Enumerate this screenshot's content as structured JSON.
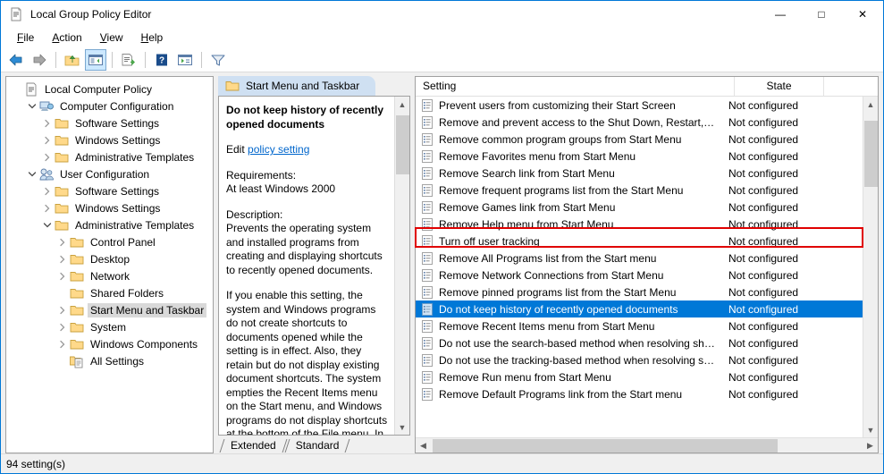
{
  "window": {
    "title": "Local Group Policy Editor",
    "icon": "policy-editor-icon",
    "controls": {
      "minimize": "—",
      "maximize": "□",
      "close": "✕"
    }
  },
  "menubar": [
    {
      "label": "File",
      "accel": "F"
    },
    {
      "label": "Action",
      "accel": "A"
    },
    {
      "label": "View",
      "accel": "V"
    },
    {
      "label": "Help",
      "accel": "H"
    }
  ],
  "toolbar": [
    {
      "name": "back-icon",
      "active": false
    },
    {
      "name": "forward-icon",
      "active": false
    },
    {
      "sep": true
    },
    {
      "name": "up-folder-icon",
      "active": false
    },
    {
      "name": "show-hide-tree-icon",
      "active": true
    },
    {
      "sep": true
    },
    {
      "name": "export-list-icon",
      "active": false
    },
    {
      "sep": true
    },
    {
      "name": "help-icon",
      "active": false
    },
    {
      "name": "properties-icon",
      "active": false
    },
    {
      "sep": true
    },
    {
      "name": "filter-icon",
      "active": false
    }
  ],
  "tree": {
    "items": [
      {
        "label": "Local Computer Policy",
        "depth": 0,
        "twisty": "none",
        "icon": "policy-icon",
        "selected": false
      },
      {
        "label": "Computer Configuration",
        "depth": 1,
        "twisty": "open",
        "icon": "computer-icon",
        "selected": false
      },
      {
        "label": "Software Settings",
        "depth": 2,
        "twisty": "closed",
        "icon": "folder-icon",
        "selected": false
      },
      {
        "label": "Windows Settings",
        "depth": 2,
        "twisty": "closed",
        "icon": "folder-icon",
        "selected": false
      },
      {
        "label": "Administrative Templates",
        "depth": 2,
        "twisty": "closed",
        "icon": "folder-icon",
        "selected": false
      },
      {
        "label": "User Configuration",
        "depth": 1,
        "twisty": "open",
        "icon": "user-icon",
        "selected": false
      },
      {
        "label": "Software Settings",
        "depth": 2,
        "twisty": "closed",
        "icon": "folder-icon",
        "selected": false
      },
      {
        "label": "Windows Settings",
        "depth": 2,
        "twisty": "closed",
        "icon": "folder-icon",
        "selected": false
      },
      {
        "label": "Administrative Templates",
        "depth": 2,
        "twisty": "open",
        "icon": "folder-icon",
        "selected": false
      },
      {
        "label": "Control Panel",
        "depth": 3,
        "twisty": "closed",
        "icon": "folder-icon",
        "selected": false
      },
      {
        "label": "Desktop",
        "depth": 3,
        "twisty": "closed",
        "icon": "folder-icon",
        "selected": false
      },
      {
        "label": "Network",
        "depth": 3,
        "twisty": "closed",
        "icon": "folder-icon",
        "selected": false
      },
      {
        "label": "Shared Folders",
        "depth": 3,
        "twisty": "none",
        "icon": "folder-icon",
        "selected": false
      },
      {
        "label": "Start Menu and Taskbar",
        "depth": 3,
        "twisty": "closed",
        "icon": "folder-icon",
        "selected": true
      },
      {
        "label": "System",
        "depth": 3,
        "twisty": "closed",
        "icon": "folder-icon",
        "selected": false
      },
      {
        "label": "Windows Components",
        "depth": 3,
        "twisty": "closed",
        "icon": "folder-icon",
        "selected": false
      },
      {
        "label": "All Settings",
        "depth": 3,
        "twisty": "none",
        "icon": "all-settings-icon",
        "selected": false
      }
    ]
  },
  "details": {
    "tab_label": "Start Menu and Taskbar",
    "tab_icon": "folder-icon",
    "policy_title": "Do not keep history of recently opened documents",
    "edit_prefix": "Edit ",
    "edit_link": "policy setting",
    "requirements_label": "Requirements:",
    "requirements_value": "At least Windows 2000",
    "description_label": "Description:",
    "description_p1": "Prevents the operating system and installed programs from creating and displaying shortcuts to recently opened documents.",
    "description_p2": "If you enable this setting, the system and Windows programs do not create shortcuts to documents opened while the setting is in effect. Also, they retain but do not display existing document shortcuts. The system empties the Recent Items menu on the Start menu, and Windows programs do not display shortcuts at the bottom of the File menu. In",
    "bottom_tabs": [
      {
        "label": "Extended",
        "active": false
      },
      {
        "label": "Standard",
        "active": true
      }
    ]
  },
  "list": {
    "columns": {
      "setting": "Setting",
      "state": "State"
    },
    "rows": [
      {
        "setting": "Prevent users from customizing their Start Screen",
        "state": "Not configured",
        "selected": false
      },
      {
        "setting": "Remove and prevent access to the Shut Down, Restart, Sleep...",
        "state": "Not configured",
        "selected": false
      },
      {
        "setting": "Remove common program groups from Start Menu",
        "state": "Not configured",
        "selected": false
      },
      {
        "setting": "Remove Favorites menu from Start Menu",
        "state": "Not configured",
        "selected": false
      },
      {
        "setting": "Remove Search link from Start Menu",
        "state": "Not configured",
        "selected": false
      },
      {
        "setting": "Remove frequent programs list from the Start Menu",
        "state": "Not configured",
        "selected": false
      },
      {
        "setting": "Remove Games link from Start Menu",
        "state": "Not configured",
        "selected": false
      },
      {
        "setting": "Remove Help menu from Start Menu",
        "state": "Not configured",
        "selected": false
      },
      {
        "setting": "Turn off user tracking",
        "state": "Not configured",
        "selected": false
      },
      {
        "setting": "Remove All Programs list from the Start menu",
        "state": "Not configured",
        "selected": false
      },
      {
        "setting": "Remove Network Connections from Start Menu",
        "state": "Not configured",
        "selected": false
      },
      {
        "setting": "Remove pinned programs list from the Start Menu",
        "state": "Not configured",
        "selected": false
      },
      {
        "setting": "Do not keep history of recently opened documents",
        "state": "Not configured",
        "selected": true
      },
      {
        "setting": "Remove Recent Items menu from Start Menu",
        "state": "Not configured",
        "selected": false
      },
      {
        "setting": "Do not use the search-based method when resolving shell s...",
        "state": "Not configured",
        "selected": false
      },
      {
        "setting": "Do not use the tracking-based method when resolving shell ...",
        "state": "Not configured",
        "selected": false
      },
      {
        "setting": "Remove Run menu from Start Menu",
        "state": "Not configured",
        "selected": false
      },
      {
        "setting": "Remove Default Programs link from the Start menu",
        "state": "Not configured",
        "selected": false
      }
    ]
  },
  "statusbar": {
    "text": "94 setting(s)"
  },
  "colors": {
    "accent": "#0078d7",
    "annotation": "#e00000",
    "link": "#0066cc",
    "folder": "#ffd98a"
  }
}
